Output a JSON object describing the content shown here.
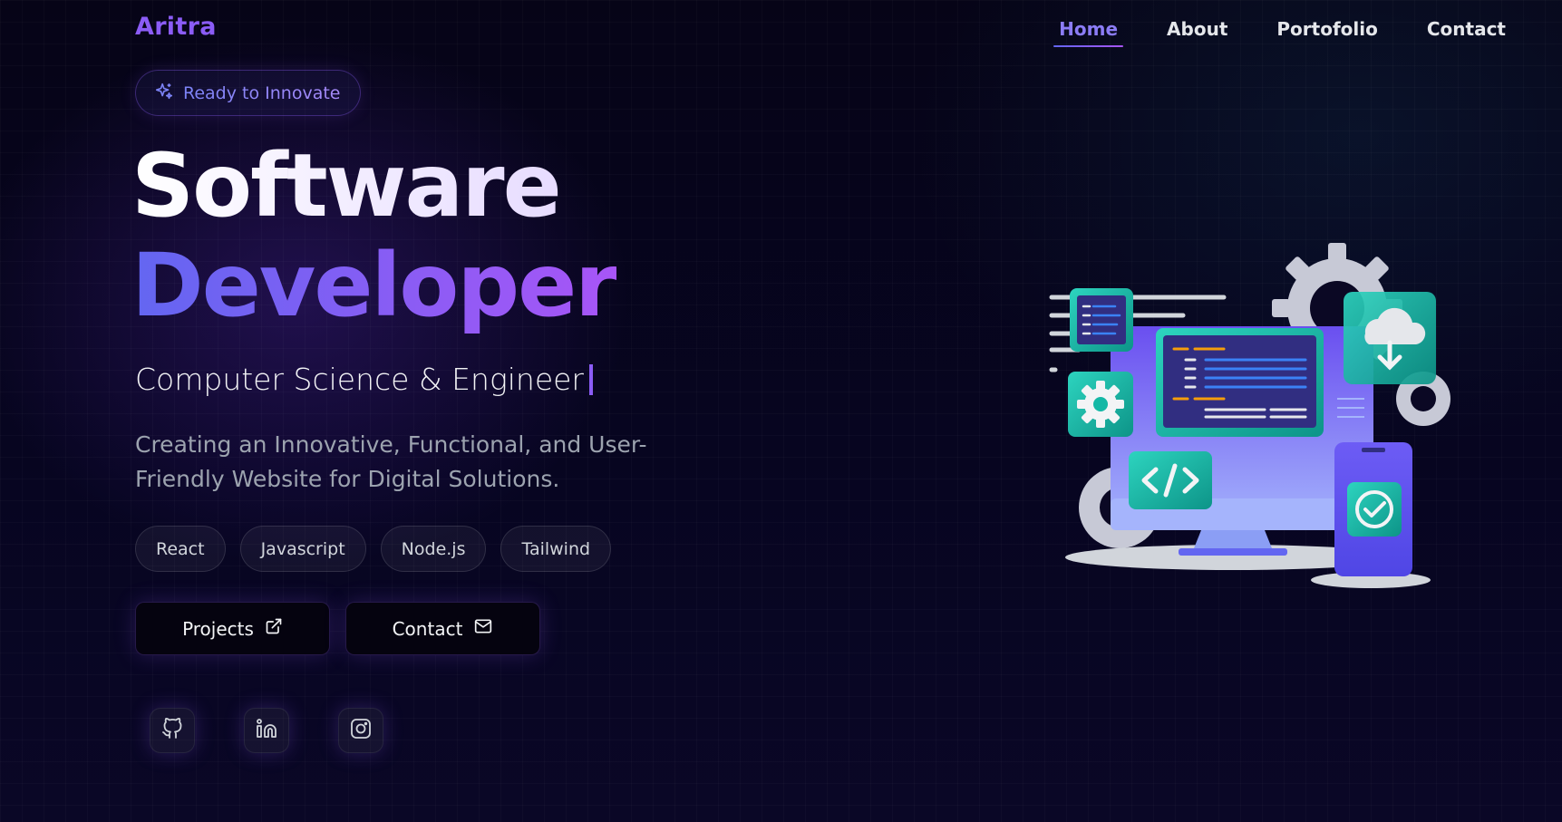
{
  "brand": {
    "name": "Aritra"
  },
  "nav": {
    "items": [
      {
        "label": "Home",
        "active": true
      },
      {
        "label": "About",
        "active": false
      },
      {
        "label": "Portofolio",
        "active": false
      },
      {
        "label": "Contact",
        "active": false
      }
    ]
  },
  "hero": {
    "badge": {
      "icon": "sparkles-icon",
      "label": "Ready to Innovate"
    },
    "title_line1": "Software",
    "title_line2": "Developer",
    "subtitle": "Computer Science & Engineer",
    "description": "Creating an Innovative, Functional, and User-Friendly Website for Digital Solutions.",
    "tags": [
      "React",
      "Javascript",
      "Node.js",
      "Tailwind"
    ],
    "buttons": {
      "projects": {
        "label": "Projects",
        "icon": "external-link-icon"
      },
      "contact": {
        "label": "Contact",
        "icon": "mail-icon"
      }
    },
    "socials": [
      {
        "name": "github-icon"
      },
      {
        "name": "linkedin-icon"
      },
      {
        "name": "instagram-icon"
      }
    ]
  },
  "colors": {
    "background": "#06041a",
    "accent_indigo": "#6366f1",
    "accent_purple": "#a855f7",
    "teal": "#2dd4bf"
  }
}
